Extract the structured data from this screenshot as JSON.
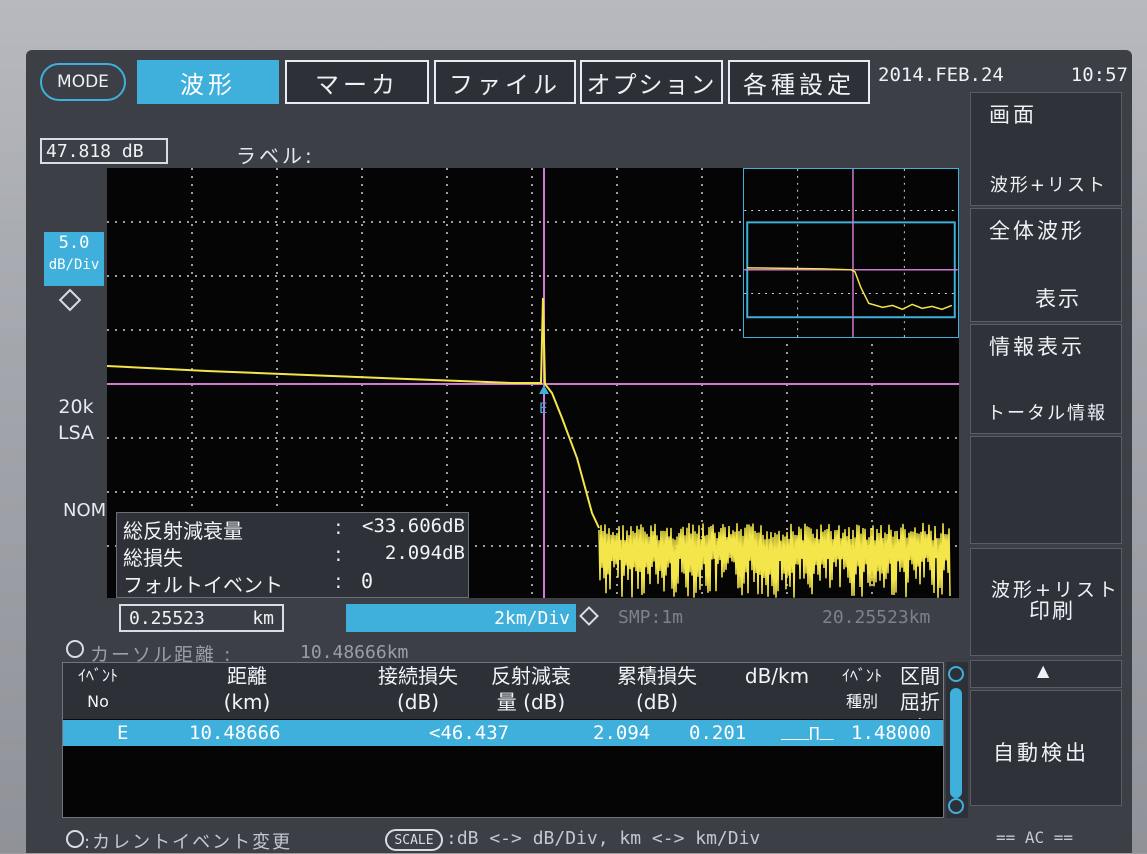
{
  "menu": {
    "mode_label": "MODE",
    "tabs": [
      {
        "label": "波形",
        "active": true
      },
      {
        "label": "マーカ",
        "active": false
      },
      {
        "label": "ファイル",
        "active": false
      },
      {
        "label": "オプション",
        "active": false
      },
      {
        "label": "各種設定",
        "active": false
      }
    ],
    "date": "2014.FEB.24",
    "time": "10:57"
  },
  "softkeys": [
    {
      "title": "画面",
      "value": "波形+リスト"
    },
    {
      "title": "全体波形",
      "value": "表示"
    },
    {
      "title": "情報表示",
      "value": "トータル情報"
    },
    {
      "title": "",
      "value": ""
    },
    {
      "title": "波形+リスト",
      "value": "印刷"
    },
    {
      "title": "",
      "value": "▲"
    },
    {
      "title": "自動検出",
      "value": ""
    }
  ],
  "trace": {
    "db_readout": "47.818 dB",
    "label_prefix": "ラベル:",
    "scale_value": "5.0",
    "scale_unit": "dB/Div",
    "pulse_width": "20k",
    "pulse_unit": "LSA",
    "mode_nom": "NOM",
    "event_marker": "E",
    "start_km": "0.25523",
    "start_unit": "km",
    "km_div": "2km/Div",
    "smp": "SMP:1m",
    "end_km": "20.25523km",
    "cursor_label": "カーソル距離 :",
    "cursor_value": "10.48666km"
  },
  "info": {
    "rows": [
      {
        "label": "総反射減衰量",
        "sep": ":",
        "value": "<33.606dB"
      },
      {
        "label": "総損失",
        "sep": ":",
        "value": "2.094dB"
      },
      {
        "label": "フォルトイベント",
        "sep": ":",
        "value": "0"
      }
    ]
  },
  "table": {
    "headers": [
      {
        "l1": "ｲﾍﾞﾝﾄ",
        "l2": "No"
      },
      {
        "l1": "距離",
        "l2": "(km)"
      },
      {
        "l1": "接続損失",
        "l2": "(dB)"
      },
      {
        "l1": "反射減衰",
        "l2": "量  (dB)"
      },
      {
        "l1": "累積損失",
        "l2": "(dB)"
      },
      {
        "l1": "dB/km",
        "l2": ""
      },
      {
        "l1": "ｲﾍﾞﾝﾄ",
        "l2": "種別"
      },
      {
        "l1": "区間",
        "l2": "屈折率"
      }
    ],
    "rows": [
      {
        "no": "E",
        "distance": "10.48666",
        "splice": "",
        "reflect": "<46.437",
        "cumulative": "2.094",
        "dbkm": "0.201",
        "type": "⎽⎽∏⎽",
        "ior": "1.48000"
      }
    ]
  },
  "footer": {
    "left_hint": ":カレントイベント変更",
    "scale_key": "SCALE",
    "scale_hint": ":dB <-> dB/Div, km <-> km/Div",
    "ac": "== AC =="
  },
  "colors": {
    "accent": "#3fb0dc",
    "trace": "#ffee33",
    "marker": "#cc66cc"
  }
}
